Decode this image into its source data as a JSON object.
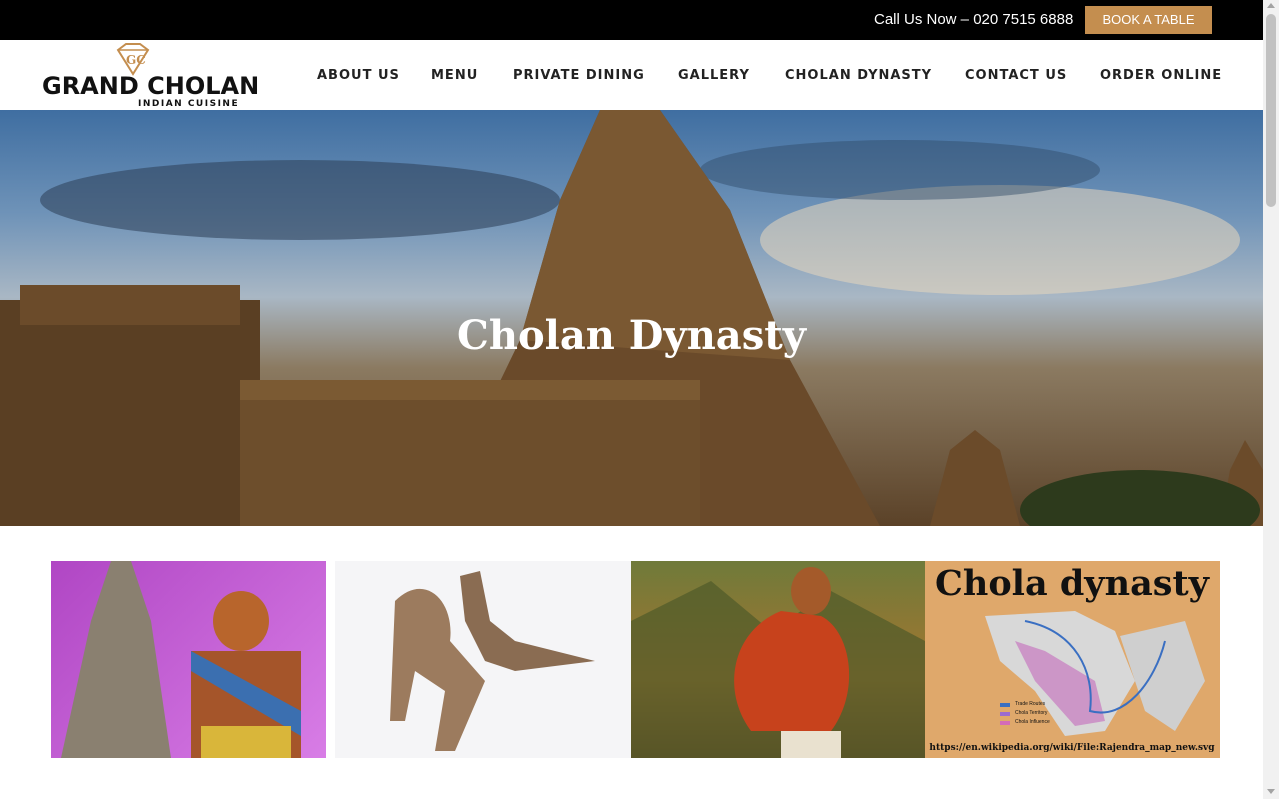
{
  "topbar": {
    "call_text": "Call Us Now – 020 7515 6888",
    "book_label": "BOOK A TABLE"
  },
  "brand": {
    "name": "GRAND CHOLAN",
    "tagline": "INDIAN CUISINE"
  },
  "nav": {
    "items": [
      {
        "label": "ABOUT US"
      },
      {
        "label": "MENU"
      },
      {
        "label": "PRIVATE DINING"
      },
      {
        "label": "GALLERY"
      },
      {
        "label": "CHOLAN DYNASTY"
      },
      {
        "label": "CONTACT US"
      },
      {
        "label": "ORDER ONLINE"
      }
    ]
  },
  "hero": {
    "title": "Cholan Dynasty"
  },
  "gallery": {
    "map_title": "Chola dynasty",
    "map_caption": "https://en.wikipedia.org/wiki/File:Rajendra_map_new.svg",
    "legend": [
      "Trade Routes",
      "Chola Territory",
      "Chola Influence"
    ]
  },
  "colors": {
    "accent": "#c48e4f",
    "topbar": "#000000"
  }
}
